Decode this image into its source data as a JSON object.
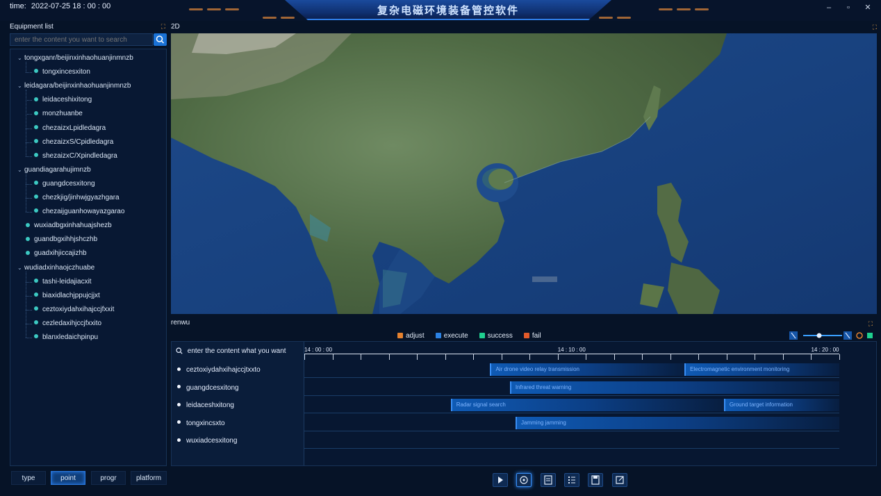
{
  "header": {
    "time_label": "time:",
    "time_value": "2022-07-25 18 : 00 : 00",
    "app_title": "复杂电磁环境装备管控软件",
    "minimize": "–",
    "maximize": "▫",
    "close": "✕"
  },
  "equipment": {
    "title": "Equipment list",
    "search_placeholder": "enter the content you want to search",
    "tree": [
      {
        "label": "tongxganr/beijinxinhaohuanjinmnzb",
        "level": 0,
        "group": true
      },
      {
        "label": "tongxincesxiton",
        "level": 1
      },
      {
        "label": "leidagara/beijinxinhaohuanjinmnzb",
        "level": 0,
        "group": true
      },
      {
        "label": "leidaceshixitong",
        "level": 1
      },
      {
        "label": "monzhuanbe",
        "level": 1
      },
      {
        "label": "chezaizxLpidledagra",
        "level": 1
      },
      {
        "label": "chezaizxS/Cpidledagra",
        "level": 1
      },
      {
        "label": "shezaizxC/Xpindledagra",
        "level": 1
      },
      {
        "label": "guandiagarahujimnzb",
        "level": 0,
        "group": true
      },
      {
        "label": "guangdcesxitong",
        "level": 1
      },
      {
        "label": "chezkjig/jinhwjgyazhgara",
        "level": 1
      },
      {
        "label": "chezaijguanhowayazgarao",
        "level": 1
      },
      {
        "label": "wuxiadbgxinhahuajshezb",
        "level": 0
      },
      {
        "label": "guandbgxihhjshczhb",
        "level": 0
      },
      {
        "label": "guadxihjiccajizhb",
        "level": 0
      },
      {
        "label": "wudiadxinhaojczhuabe",
        "level": 0,
        "group": true
      },
      {
        "label": "tashi-leidajiacxit",
        "level": 1
      },
      {
        "label": "biaxidlachjppujcjjxt",
        "level": 1
      },
      {
        "label": "ceztoxiydahxihajccjfxxit",
        "level": 1
      },
      {
        "label": "cezledaxihjccjfxxito",
        "level": 1
      },
      {
        "label": "blanxledaichpinpu",
        "level": 1
      }
    ]
  },
  "tabs": [
    "type",
    "point",
    "progr",
    "platform"
  ],
  "active_tab": "point",
  "map": {
    "mode_label": "2D"
  },
  "timeline": {
    "title": "renwu",
    "legend": [
      {
        "label": "adjust",
        "color": "#e5822f"
      },
      {
        "label": "execute",
        "color": "#2b82e4"
      },
      {
        "label": "success",
        "color": "#1fd08f"
      },
      {
        "label": "fail",
        "color": "#e25a2a"
      }
    ],
    "search_placeholder": "enter the content what you want",
    "time_labels": [
      "14 : 00 : 00",
      "14 : 10 : 00",
      "14 : 20 : 00"
    ],
    "rows": [
      {
        "name": "ceztoxiydahxihajccjtxxto",
        "tasks": [
          {
            "label": "Air drone video relay transmission",
            "start": 6.6,
            "end": 13.5
          },
          {
            "label": "Electromagnetic environment monitoring",
            "start": 13.5,
            "end": 19.0
          }
        ]
      },
      {
        "name": "guangdcesxitong",
        "tasks": [
          {
            "label": "Infrared threat warning",
            "start": 7.3,
            "end": 19.0
          }
        ]
      },
      {
        "name": "leidaceshxitong",
        "tasks": [
          {
            "label": "Radar signal search",
            "start": 5.2,
            "end": 14.9
          },
          {
            "label": "Ground target information",
            "start": 14.9,
            "end": 19.0
          }
        ]
      },
      {
        "name": "tongxincsxto",
        "tasks": [
          {
            "label": "Jamming jamming",
            "start": 7.5,
            "end": 19.0
          }
        ]
      },
      {
        "name": "wuxiadcesxitong",
        "tasks": []
      }
    ]
  },
  "controls": [
    "play",
    "target",
    "report",
    "list",
    "save",
    "export"
  ]
}
